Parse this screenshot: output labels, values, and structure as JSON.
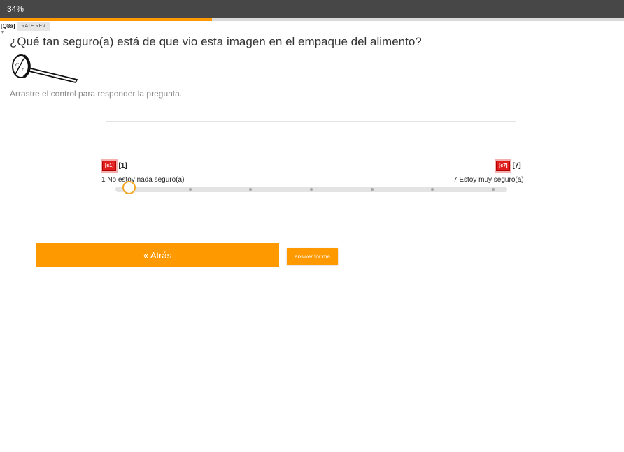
{
  "progress": {
    "label": "34%",
    "value": 0.34
  },
  "question": {
    "id": "[Q8a]",
    "tag": "RATE REV",
    "text": "¿Qué tan seguro(a) está de que vio esta imagen en el empaque del alimento?",
    "image_icon": "thermometer-dial-icon",
    "instruction": "Arrastre el control para responder la pregunta."
  },
  "slider": {
    "left_code": "[c1]",
    "left_value": "[1]",
    "left_label": "1 No estoy nada seguro(a)",
    "right_code": "[c7]",
    "right_value": "[7]",
    "right_label": "7 Estoy muy seguro(a)",
    "current_value": 1,
    "min": 1,
    "max": 7
  },
  "buttons": {
    "back": "« Atrás",
    "answer_for_me": "answer for me"
  },
  "colors": {
    "accent": "#ff9900",
    "topbar": "#474747",
    "badge": "#e11d1d"
  }
}
